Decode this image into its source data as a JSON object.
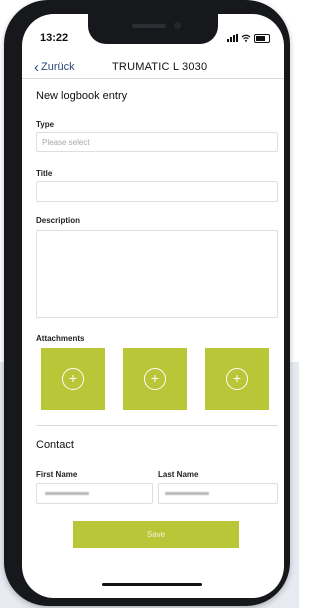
{
  "status_bar": {
    "time": "13:22"
  },
  "nav": {
    "back_label": "Zurück",
    "title": "TRUMATIC L 3030"
  },
  "form": {
    "heading": "New logbook entry",
    "type_label": "Type",
    "type_placeholder": "Please select",
    "title_label": "Title",
    "title_value": "",
    "description_label": "Description",
    "description_value": "",
    "attachments_label": "Attachments",
    "attachment_slots": 3
  },
  "contact": {
    "heading": "Contact",
    "first_name_label": "First Name",
    "last_name_label": "Last Name"
  },
  "actions": {
    "save_label": "Save"
  },
  "colors": {
    "accent": "#b8c638",
    "link": "#2a4a7a",
    "phone_frame": "#16181c"
  },
  "icons": [
    "chevron-left-icon",
    "plus-circle-icon",
    "signal-icon",
    "wifi-icon",
    "battery-icon"
  ]
}
